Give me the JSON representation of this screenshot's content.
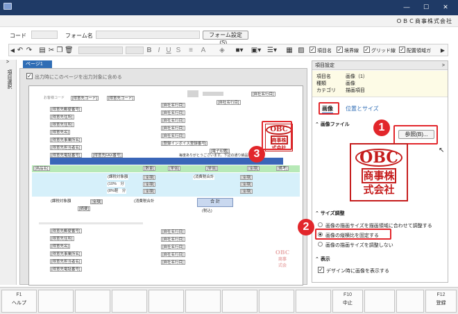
{
  "window": {
    "company": "ＯＢＣ商事株式会社",
    "min": "—",
    "max": "☐",
    "close": "✕"
  },
  "form": {
    "code_label": "コード",
    "name_label": "フォーム名",
    "settings_button": "フォーム設定(S)..."
  },
  "toolbar": {
    "checks": [
      {
        "label": "項目名",
        "checked": true
      },
      {
        "label": "境界線",
        "checked": true
      },
      {
        "label": "グリッド線",
        "checked": true
      },
      {
        "label": "配置領域ガ",
        "checked": true
      }
    ]
  },
  "side_tab": "項目選択",
  "canvas": {
    "page_tab": "ページ1",
    "print_check": "出力時にこのページを出力対象に含める",
    "fields": {
      "customer_code": "[得意先コード]",
      "customer_zip": "[得意先郵便番号]",
      "customer_addr1": "[得意先住所]",
      "customer_addr2": "[得意先住所]",
      "customer_name": "[得意先名]",
      "dept": "[得意先事業所名]",
      "person": "[得意先担当者名]",
      "tel": "[得意先電話番号]",
      "fax": "[得意先FAX番号]",
      "company1": "[自社名行目]",
      "company2": "[自社名行目]",
      "company3": "[自社名行目]",
      "company4": "[自社名行目]",
      "invoice_reg": "[登録インボイス登録番号]",
      "item_name": "[商品名]",
      "qty": "[数量]",
      "unit_price": "[単価]",
      "amount": "[金額]",
      "remarks": "[備考]",
      "taxable": "(課税対象額",
      "tax10": "(10%　分",
      "tax8": "(8%軽　分",
      "tax_total": "(消費税合計",
      "doc_stamp": "[電子印鑑]",
      "notice": "毎度ありがとうございます。下記の通り納品致します。",
      "total": "合 計",
      "tax_inc": "(税込)",
      "memo": "[摘要]"
    },
    "stamp": {
      "line1": "OBC",
      "line2": "商事株",
      "line3": "式会社"
    },
    "watermark": {
      "line1": "OBC",
      "line2": "商事",
      "line3": "式会"
    }
  },
  "panel": {
    "header": "項目設定",
    "header_arrow": ">",
    "info": [
      {
        "k": "項目名",
        "v": "画像（1）"
      },
      {
        "k": "種類",
        "v": "画像"
      },
      {
        "k": "カテゴリ",
        "v": "描画項目"
      }
    ],
    "tabs": {
      "image": "画像",
      "position": "位置とサイズ"
    },
    "image_section": "画像ファイル",
    "browse_button": "参照(B)...",
    "preview": {
      "line1": "OBC",
      "line2": "商事株",
      "line3": "式会社"
    },
    "size_section": "サイズ調整",
    "size_options": [
      {
        "label": "画像の描画サイズを描画領域に合わせて調整する",
        "checked": false
      },
      {
        "label": "画像の縦横比を固定する",
        "checked": true
      },
      {
        "label": "画像の描画サイズを調整しない",
        "checked": false
      }
    ],
    "display_section": "表示",
    "display_check": "デザイン時に画像を表示する"
  },
  "badges": [
    "1",
    "2",
    "3"
  ],
  "fkeys": [
    {
      "key": "F1",
      "label": "ヘルプ"
    },
    {
      "key": "",
      "label": ""
    },
    {
      "key": "",
      "label": ""
    },
    {
      "key": "",
      "label": ""
    },
    {
      "key": "",
      "label": ""
    },
    {
      "key": "",
      "label": ""
    },
    {
      "key": "",
      "label": ""
    },
    {
      "key": "",
      "label": ""
    },
    {
      "key": "",
      "label": ""
    },
    {
      "key": "F10",
      "label": "中止"
    },
    {
      "key": "",
      "label": ""
    },
    {
      "key": "",
      "label": ""
    },
    {
      "key": "F12",
      "label": "登録"
    }
  ],
  "colors": {
    "title_bar": "#1f3a66",
    "accent": "#2f6db5",
    "highlight": "#e2262b",
    "stamp": "#c51c1c"
  }
}
